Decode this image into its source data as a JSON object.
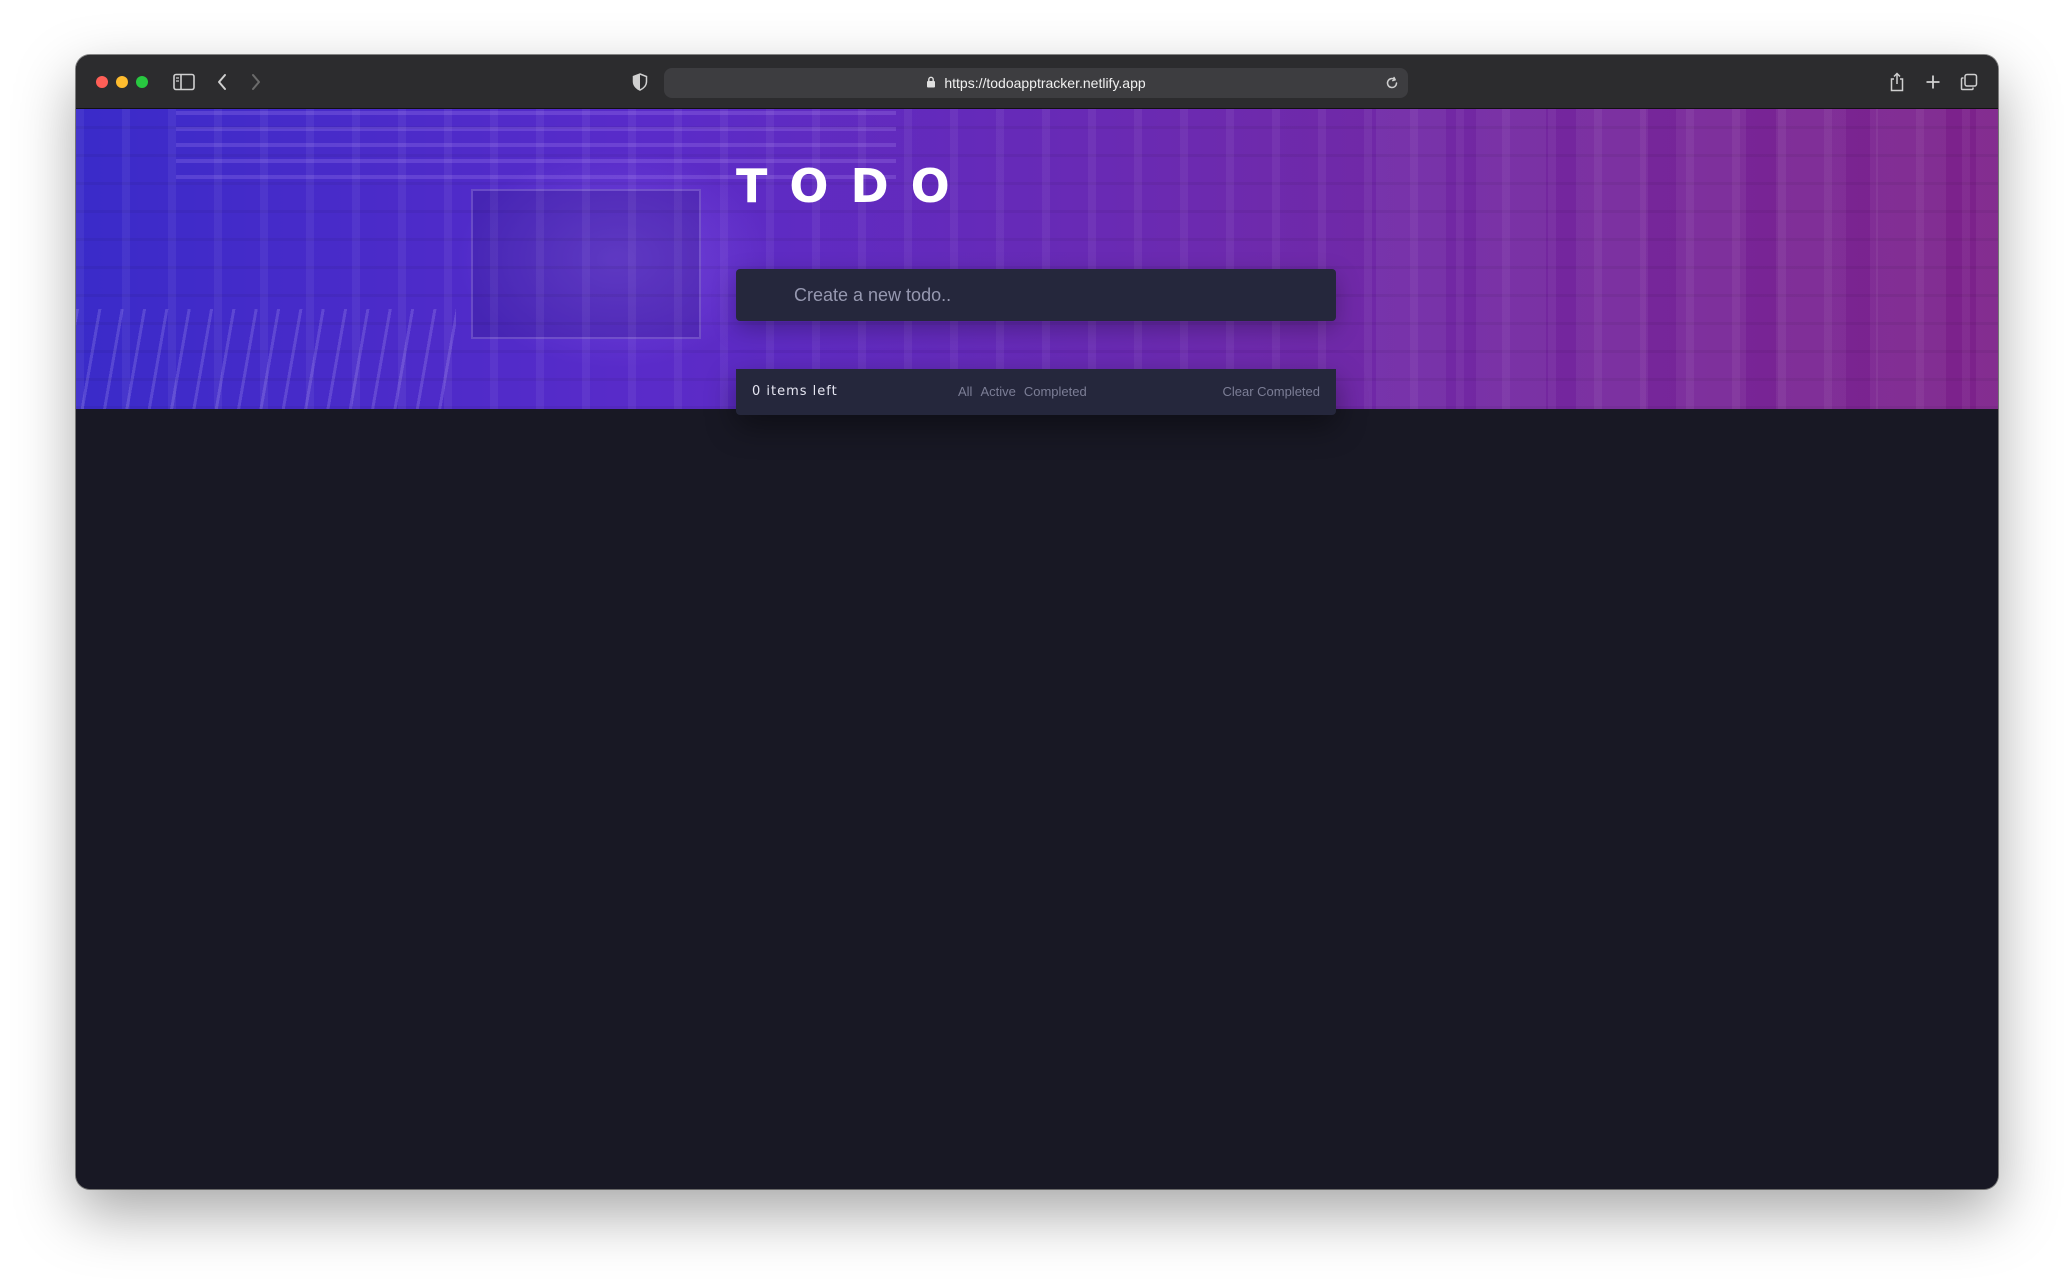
{
  "browser": {
    "url": "https://todoapptracker.netlify.app"
  },
  "app": {
    "title": "TODO",
    "new_todo_placeholder": "Create a new todo..",
    "items_left": "0 items left",
    "filters": [
      "All",
      "Active",
      "Completed"
    ],
    "clear_completed": "Clear Completed"
  },
  "colors": {
    "page_background": "#181824",
    "card_background": "#25273c",
    "gradient_start": "#3a2bc9",
    "gradient_end": "#7d228a"
  }
}
